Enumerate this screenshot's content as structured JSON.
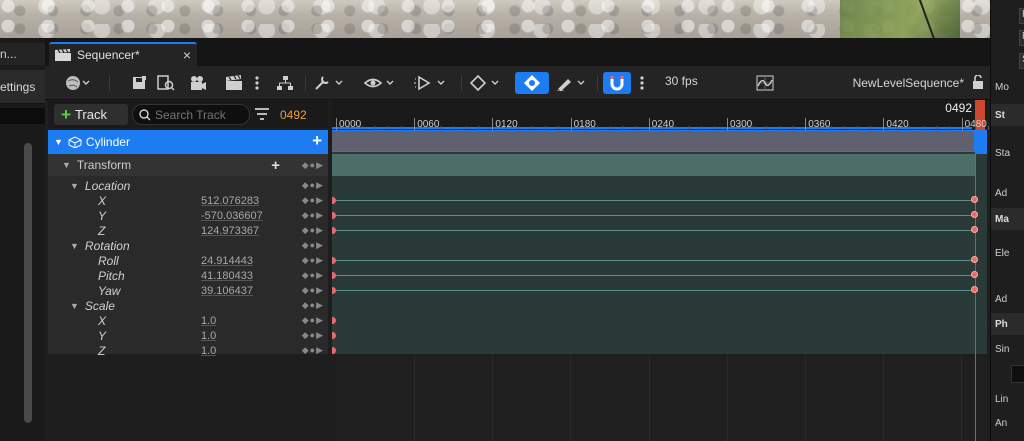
{
  "left_panel": {
    "tab_label": "n...",
    "settings_label": "ettings"
  },
  "sequencer": {
    "tab_title": "Sequencer*",
    "close_glyph": "×",
    "fps_label": "30 fps",
    "sequence_name": "NewLevelSequence*",
    "add_track_label": "Track",
    "search_placeholder": "Search Track",
    "current_frame": "0492",
    "playhead_frame": "0492",
    "ruler_ticks": [
      "0000",
      "0060",
      "0120",
      "0180",
      "0240",
      "0300",
      "0360",
      "0420",
      "0480"
    ]
  },
  "tracks": {
    "actor_name": "Cylinder",
    "transform_label": "Transform",
    "location_label": "Location",
    "rotation_label": "Rotation",
    "scale_label": "Scale",
    "loc_x_label": "X",
    "loc_x_value": "512.076283",
    "loc_y_label": "Y",
    "loc_y_value": "-570.036607",
    "loc_z_label": "Z",
    "loc_z_value": "124.973367",
    "rot_roll_label": "Roll",
    "rot_roll_value": "24.914443",
    "rot_pitch_label": "Pitch",
    "rot_pitch_value": "41.180433",
    "rot_yaw_label": "Yaw",
    "rot_yaw_value": "39.106437",
    "scale_x_label": "X",
    "scale_x_value": "1.0",
    "scale_y_label": "Y",
    "scale_y_value": "1.0",
    "scale_z_label": "Z",
    "scale_z_value": "1.0",
    "nav_glyphs": "◆●▶"
  },
  "details": {
    "labels": [
      "Mo",
      "St",
      "Sta",
      "Ad",
      "Ma",
      "Ele",
      "Ad",
      "Ph",
      "Sin",
      "Lin",
      "An"
    ],
    "boxes": [
      "F",
      "R",
      "S"
    ]
  },
  "colors": {
    "accent": "#1d7cf2",
    "frame_orange": "#e8a43c",
    "playhead": "#c94a2d",
    "key": "#e86a6a",
    "add_green": "#5fcf4b"
  }
}
